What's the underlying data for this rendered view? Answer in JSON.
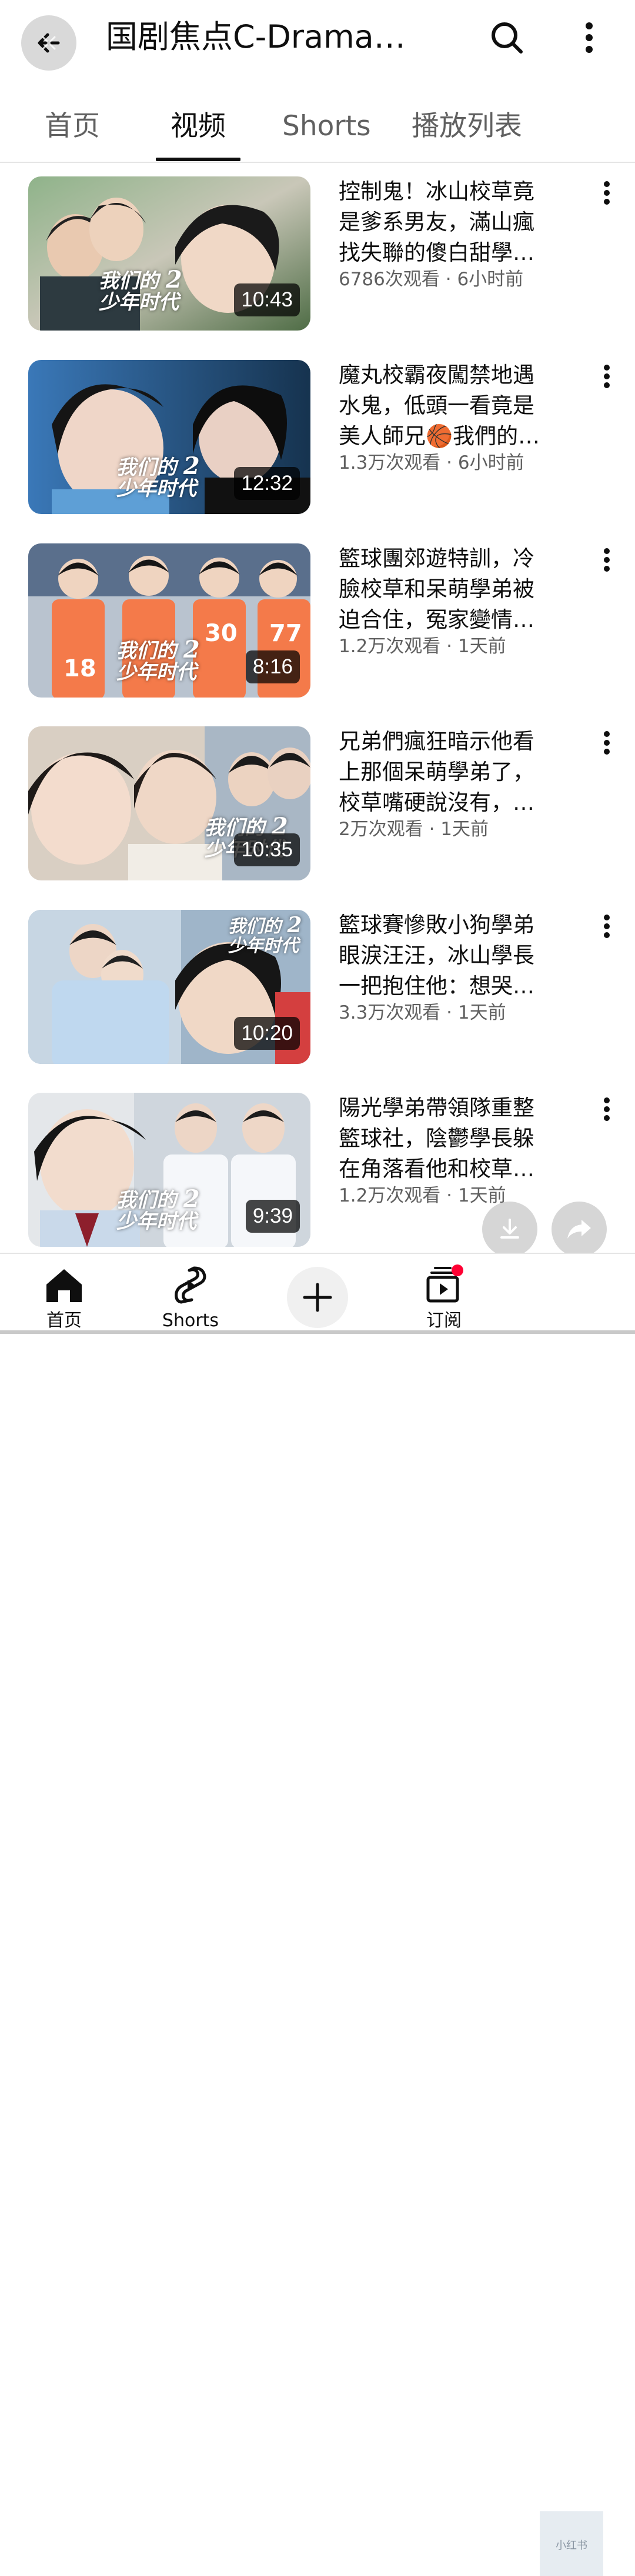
{
  "header": {
    "title": "国剧焦点C-Drama…",
    "back_icon": "back-arrow-icon",
    "search_icon": "search-icon",
    "more_icon": "more-vert-icon"
  },
  "tabs": [
    {
      "label": "首页",
      "active": false
    },
    {
      "label": "视频",
      "active": true
    },
    {
      "label": "Shorts",
      "active": false
    },
    {
      "label": "播放列表",
      "active": false
    }
  ],
  "videos": [
    {
      "title_lines": [
        "控制鬼！冰山校草竟",
        "是爹系男友，滿山瘋",
        "找失聯的傻白甜學…"
      ],
      "meta": "6786次观看 · 6小时前",
      "duration": "10:43"
    },
    {
      "title_lines": [
        "魔丸校霸夜闖禁地遇",
        "水鬼，低頭一看竟是",
        "美人師兄🏀我們的…"
      ],
      "meta": "1.3万次观看 · 6小时前",
      "duration": "12:32"
    },
    {
      "title_lines": [
        "籃球團郊遊特訓，冷",
        "臉校草和呆萌學弟被",
        "迫合住，冤家變情…"
      ],
      "meta": "1.2万次观看 · 1天前",
      "duration": "8:16"
    },
    {
      "title_lines": [
        "兄弟們瘋狂暗示他看",
        "上那個呆萌學弟了，",
        "校草嘴硬說沒有，…"
      ],
      "meta": "2万次观看 · 1天前",
      "duration": "10:35"
    },
    {
      "title_lines": [
        "籃球賽慘敗小狗學弟",
        "眼淚汪汪，冰山學長",
        "一把抱住他：想哭…"
      ],
      "meta": "3.3万次观看 · 1天前",
      "duration": "10:20"
    },
    {
      "title_lines": [
        "陽光學弟帶領隊重整",
        "籃球社，陰鬱學長躲",
        "在角落看他和校草…"
      ],
      "meta": "1.2万次观看 · 1天前",
      "duration": "9:39"
    }
  ],
  "thumb_logo": {
    "line1": "我们的",
    "line2": "少年时代",
    "num": "2"
  },
  "jerseys": [
    "18",
    "30",
    "77"
  ],
  "bottom_nav": [
    {
      "label": "首页",
      "icon": "home-icon"
    },
    {
      "label": "Shorts",
      "icon": "shorts-icon"
    },
    {
      "label": "",
      "icon": "create-plus-icon"
    },
    {
      "label": "订阅",
      "icon": "subscriptions-icon"
    }
  ],
  "floating": {
    "download_icon": "download-icon",
    "share_icon": "share-icon"
  },
  "watermark_text": "小红书",
  "colors": {
    "accent": "#0f0f0f",
    "secondary_text": "#606060",
    "badge": "#ff0033"
  }
}
